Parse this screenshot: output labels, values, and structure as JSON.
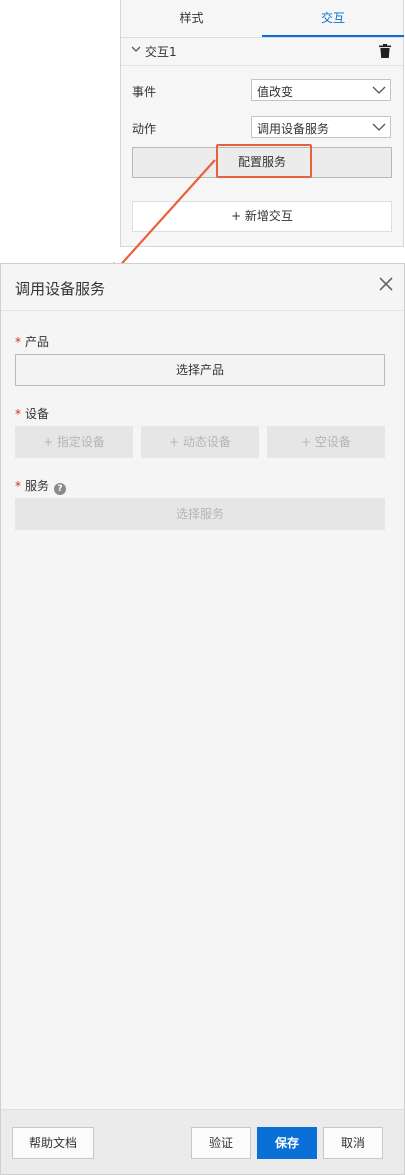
{
  "panel": {
    "tabs": [
      {
        "label": "样式"
      },
      {
        "label": "交互"
      }
    ],
    "section_title": "交互1",
    "event_label": "事件",
    "event_value": "值改变",
    "action_label": "动作",
    "action_value": "调用设备服务",
    "config_button": "配置服务",
    "add_button": "+ 新增交互"
  },
  "dialog": {
    "title": "调用设备服务",
    "required_mark": "*",
    "product_label": "产品",
    "product_button": "选择产品",
    "device_label": "设备",
    "device_buttons": [
      "+ 指定设备",
      "+ 动态设备",
      "+ 空设备"
    ],
    "service_label": "服务",
    "service_help": "?",
    "service_button": "选择服务"
  },
  "footer": {
    "help_button": "帮助文档",
    "verify_button": "验证",
    "save_button": "保存",
    "cancel_button": "取消"
  },
  "colors": {
    "accent": "#0a6fd6",
    "highlight": "#e8603d",
    "required": "#e0241b"
  }
}
